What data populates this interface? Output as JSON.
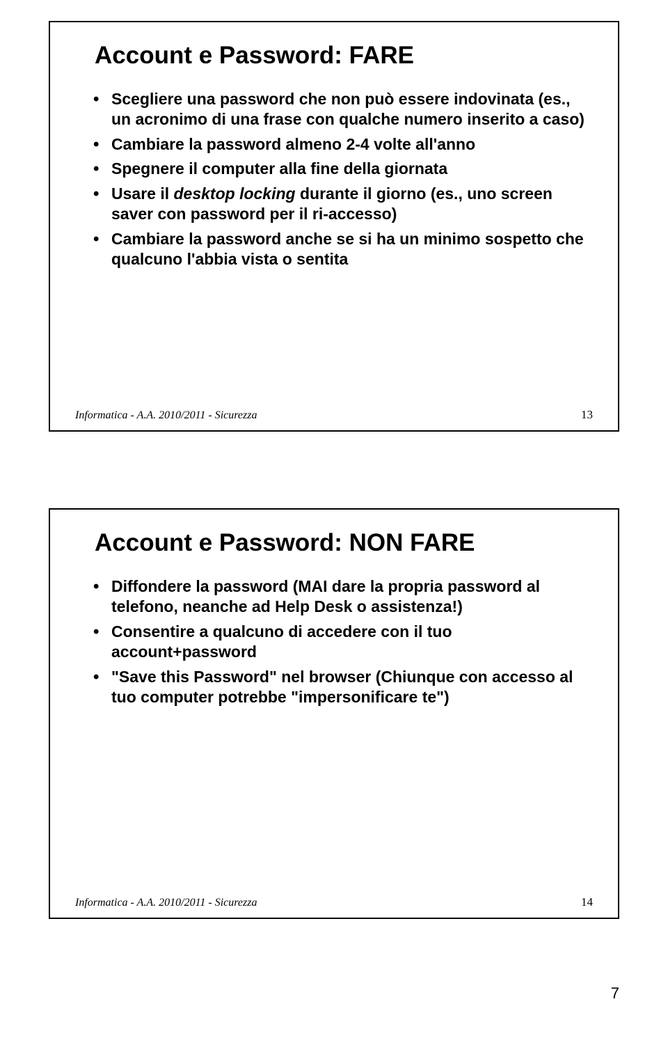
{
  "slides": [
    {
      "title": "Account e Password: FARE",
      "bullets": [
        {
          "html": "Scegliere una password che non può essere indovinata (es., un acronimo di una frase con qualche numero inserito a caso)"
        },
        {
          "html": "Cambiare la password almeno 2-4 volte all'anno"
        },
        {
          "html": "Spegnere il computer alla fine della giornata"
        },
        {
          "prefix": "Usare il ",
          "italic": "desktop locking",
          "suffix": " durante il giorno (es., uno screen saver con password per il ri-accesso)"
        },
        {
          "html": "Cambiare la password anche se si ha un minimo sospetto che qualcuno l'abbia vista o sentita"
        }
      ],
      "footer_left": "Informatica - A.A. 2010/2011 - Sicurezza",
      "footer_right": "13"
    },
    {
      "title": "Account e Password: NON FARE",
      "bullets": [
        {
          "html": "Diffondere la password (MAI dare la propria password al telefono, neanche ad Help Desk o assistenza!)"
        },
        {
          "html": "Consentire a qualcuno di accedere con il tuo account+password"
        },
        {
          "html": "\"Save this Password\" nel browser  (Chiunque con accesso al tuo computer potrebbe \"impersonificare te\")"
        }
      ],
      "footer_left": "Informatica - A.A. 2010/2011 - Sicurezza",
      "footer_right": "14"
    }
  ],
  "page_number": "7"
}
